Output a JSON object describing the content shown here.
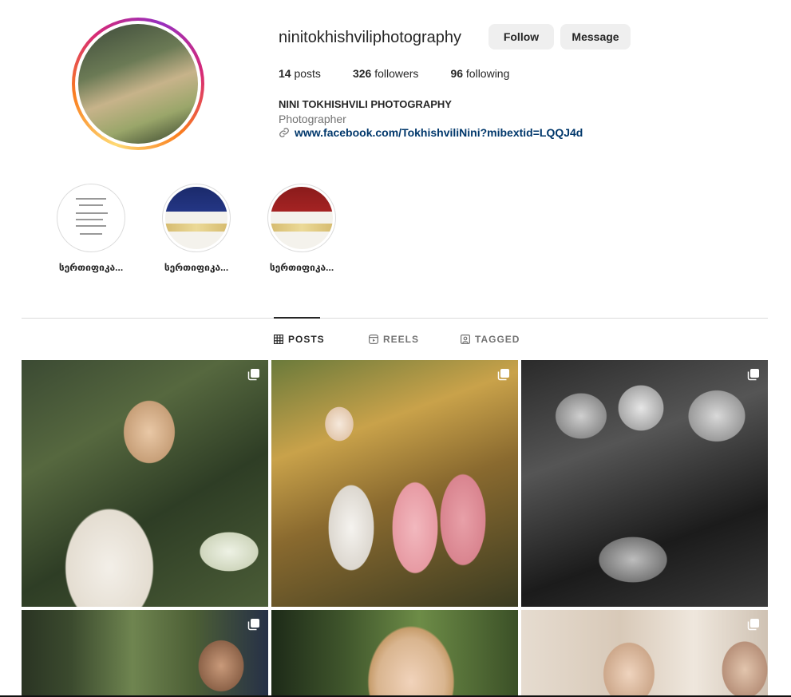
{
  "profile": {
    "username": "ninitokhishviliphotography",
    "follow_label": "Follow",
    "message_label": "Message",
    "stats": [
      {
        "count": "14",
        "label": "posts"
      },
      {
        "count": "326",
        "label": "followers"
      },
      {
        "count": "96",
        "label": "following"
      }
    ],
    "full_name": "NINI TOKHISHVILI PHOTOGRAPHY",
    "category": "Photographer",
    "link": "www.facebook.com/TokhishviliNini?mibextid=LQQJ4d"
  },
  "highlights": [
    {
      "label": "სერთიფიკა..."
    },
    {
      "label": "სერთიფიკა..."
    },
    {
      "label": "სერთიფიკა..."
    }
  ],
  "tabs": [
    {
      "label": "POSTS",
      "icon": "grid-icon",
      "active": true
    },
    {
      "label": "REELS",
      "icon": "reels-icon",
      "active": false
    },
    {
      "label": "TAGGED",
      "icon": "tagged-icon",
      "active": false
    }
  ],
  "colors": {
    "button_bg": "#efefef",
    "link": "#00376b",
    "muted": "#737373",
    "divider": "#dbdbdb"
  }
}
